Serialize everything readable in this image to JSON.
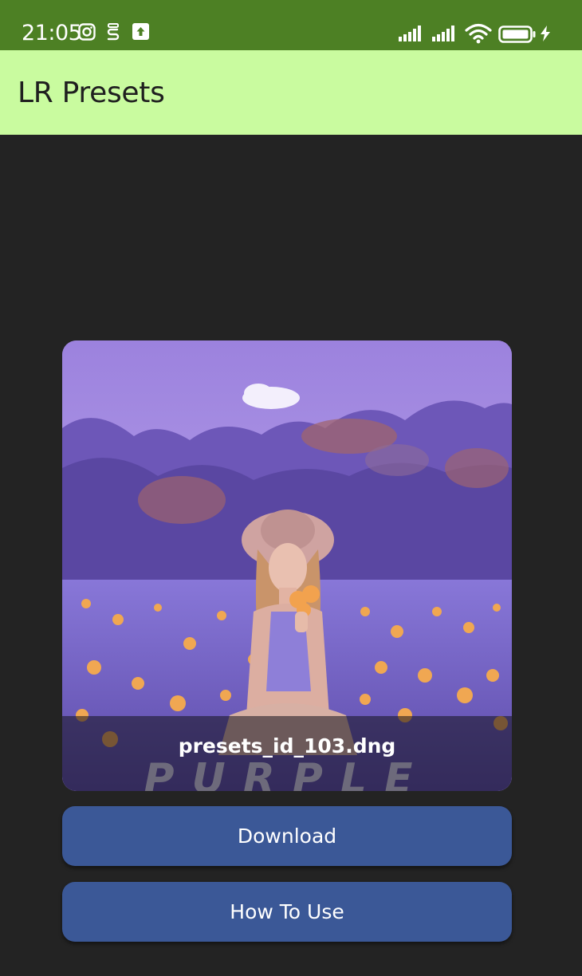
{
  "status_bar": {
    "time": "21:05",
    "left_icons": [
      "instagram-icon",
      "notification-s-icon",
      "upload-icon"
    ],
    "right_icons": [
      "signal-icon",
      "signal-icon",
      "wifi-icon",
      "battery-icon",
      "charging-icon"
    ]
  },
  "app_bar": {
    "title": "LR Presets",
    "background": "#c9fb9f"
  },
  "preset": {
    "file_name": "presets_id_103.dng",
    "image_watermark": "PURPLE"
  },
  "actions": {
    "download_label": "Download",
    "how_to_use_label": "How To Use"
  },
  "colors": {
    "status_bar": "#4d8024",
    "app_bar": "#c9fb9f",
    "background": "#232323",
    "button": "#3b5897"
  }
}
